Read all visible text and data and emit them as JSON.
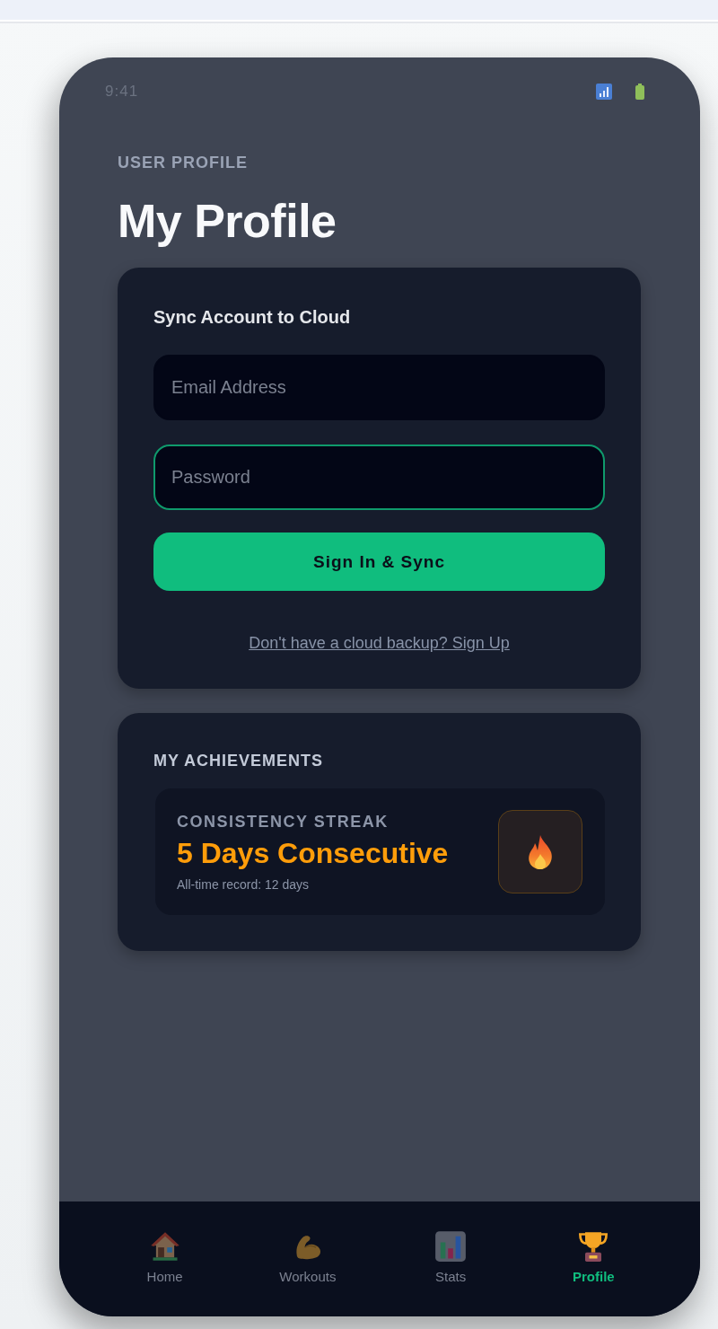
{
  "status_bar": {
    "time": "9:41"
  },
  "header": {
    "eyebrow": "USER PROFILE",
    "title": "My Profile"
  },
  "sync_card": {
    "title": "Sync Account to Cloud",
    "fields": [
      {
        "placeholder": "Email Address",
        "focused": false
      },
      {
        "placeholder": "Password",
        "focused": true
      }
    ],
    "button": "Sign In & Sync",
    "link": "Don't have a cloud backup? Sign Up"
  },
  "achievements": {
    "title": "MY ACHIEVEMENTS",
    "streak": {
      "label": "CONSISTENCY STREAK",
      "value": "5 Days Consecutive",
      "record": "All-time record: 12 days"
    }
  },
  "tab_bar": [
    {
      "label": "Home",
      "selected": false
    },
    {
      "label": "Workouts",
      "selected": false
    },
    {
      "label": "Stats",
      "selected": false
    },
    {
      "label": "Profile",
      "selected": true
    }
  ]
}
